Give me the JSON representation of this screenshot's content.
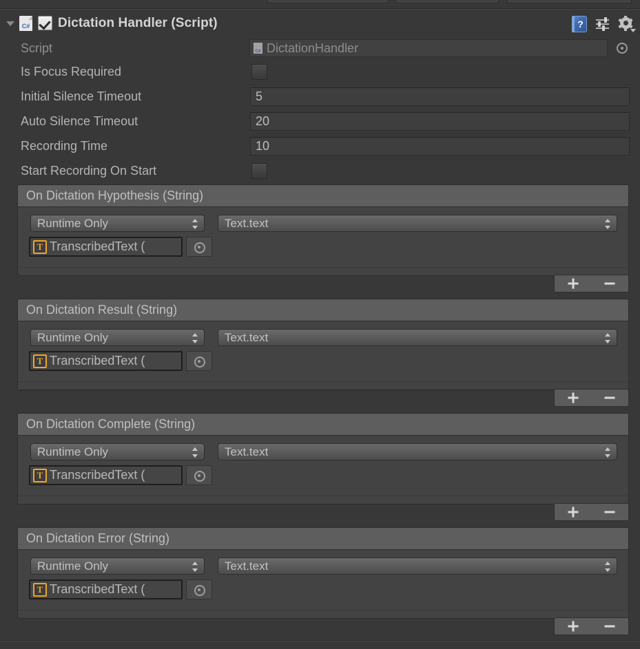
{
  "theme": {
    "bg": "#383838",
    "panel": "#434343",
    "event_header_bg": "#5e5e5e",
    "text": "#b4b4b4",
    "text_dim": "#8f8f8f",
    "accent_orange": "#f0a52a",
    "accent_blue": "#3a62b8"
  },
  "component": {
    "title": "Dictation Handler (Script)",
    "script_icon_label": "C#",
    "enabled": true,
    "help_icon_label": "?",
    "icons": {
      "foldout": "triangle-down",
      "help": "help-book",
      "preset": "preset-sliders",
      "settings": "gear"
    }
  },
  "properties": [
    {
      "label": "Script",
      "type": "object",
      "value": "DictationHandler",
      "icon_label": "C#",
      "readonly": true
    },
    {
      "label": "Is Focus Required",
      "type": "toggle",
      "value": false
    },
    {
      "label": "Initial Silence Timeout",
      "type": "number",
      "value": "5"
    },
    {
      "label": "Auto Silence Timeout",
      "type": "number",
      "value": "20"
    },
    {
      "label": "Recording Time",
      "type": "number",
      "value": "10"
    },
    {
      "label": "Start Recording On Start",
      "type": "toggle",
      "value": false
    }
  ],
  "events": [
    {
      "title": "On Dictation Hypothesis (String)",
      "mode": "Runtime Only",
      "function": "Text.text",
      "target": "TranscribedText (",
      "target_icon_label": "T",
      "add_label": "+",
      "remove_label": "−"
    },
    {
      "title": "On Dictation Result (String)",
      "mode": "Runtime Only",
      "function": "Text.text",
      "target": "TranscribedText (",
      "target_icon_label": "T",
      "add_label": "+",
      "remove_label": "−"
    },
    {
      "title": "On Dictation Complete (String)",
      "mode": "Runtime Only",
      "function": "Text.text",
      "target": "TranscribedText (",
      "target_icon_label": "T",
      "add_label": "+",
      "remove_label": "−"
    },
    {
      "title": "On Dictation Error (String)",
      "mode": "Runtime Only",
      "function": "Text.text",
      "target": "TranscribedText (",
      "target_icon_label": "T",
      "add_label": "+",
      "remove_label": "−"
    }
  ]
}
